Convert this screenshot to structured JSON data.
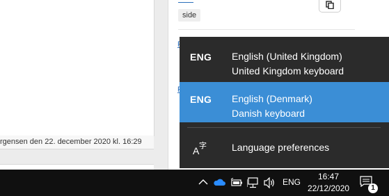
{
  "background_page": {
    "tag_label": "side",
    "meta_text": "rgensen den 22. december 2020 kl. 16:29"
  },
  "language_flyout": {
    "items": [
      {
        "code": "ENG",
        "name": "English (United Kingdom)",
        "keyboard": "United Kingdom keyboard",
        "selected": false
      },
      {
        "code": "ENG",
        "name": "English (Denmark)",
        "keyboard": "Danish keyboard",
        "selected": true
      }
    ],
    "preferences_label": "Language preferences",
    "selected_color": "#3b8ed6"
  },
  "taskbar": {
    "tray_icons": [
      "chevron-up-icon",
      "onedrive-cloud-icon",
      "battery-icon",
      "network-icon",
      "volume-icon"
    ],
    "language": "ENG",
    "time": "16:47",
    "date": "22/12/2020",
    "notification_count": "1"
  }
}
